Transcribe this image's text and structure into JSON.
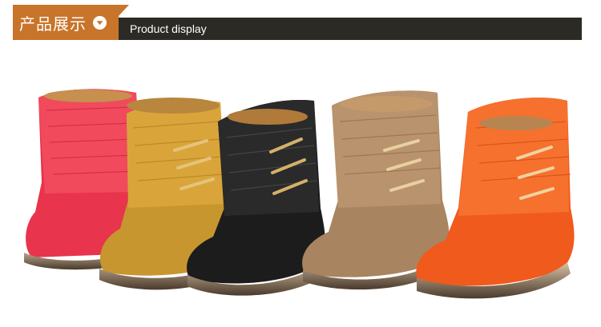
{
  "header": {
    "tag_label": "产品展示",
    "tag_icon": "chevron-down-icon",
    "title": "Product display",
    "accent_color": "#c8742a",
    "bar_color": "#2c2a24"
  },
  "product_photo": {
    "boots": [
      {
        "color": "#e8344c"
      },
      {
        "color": "#c8962e"
      },
      {
        "color": "#1c1c1c"
      },
      {
        "color": "#a88460"
      },
      {
        "color": "#f05a1c"
      }
    ]
  }
}
